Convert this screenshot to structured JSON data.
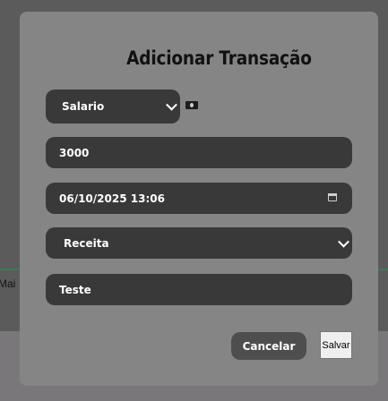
{
  "background": {
    "partial_label": "Mai"
  },
  "modal": {
    "title": "Adicionar Transação",
    "category_select": {
      "value": "Salario",
      "icon": "money-bill-icon"
    },
    "amount_input": {
      "value": "3000"
    },
    "datetime_input": {
      "value": "06/10/2025 13:06",
      "icon": "calendar-icon"
    },
    "type_select": {
      "value": "Receita"
    },
    "description_input": {
      "value": "Teste"
    },
    "cancel_label": "Cancelar",
    "save_label": "Salvar"
  },
  "colors": {
    "overlay": "#5b5b5b",
    "modal_bg": "#858585",
    "field_bg": "#393939",
    "cancel_bg": "#4e4e4e",
    "save_bg": "#efefef"
  }
}
